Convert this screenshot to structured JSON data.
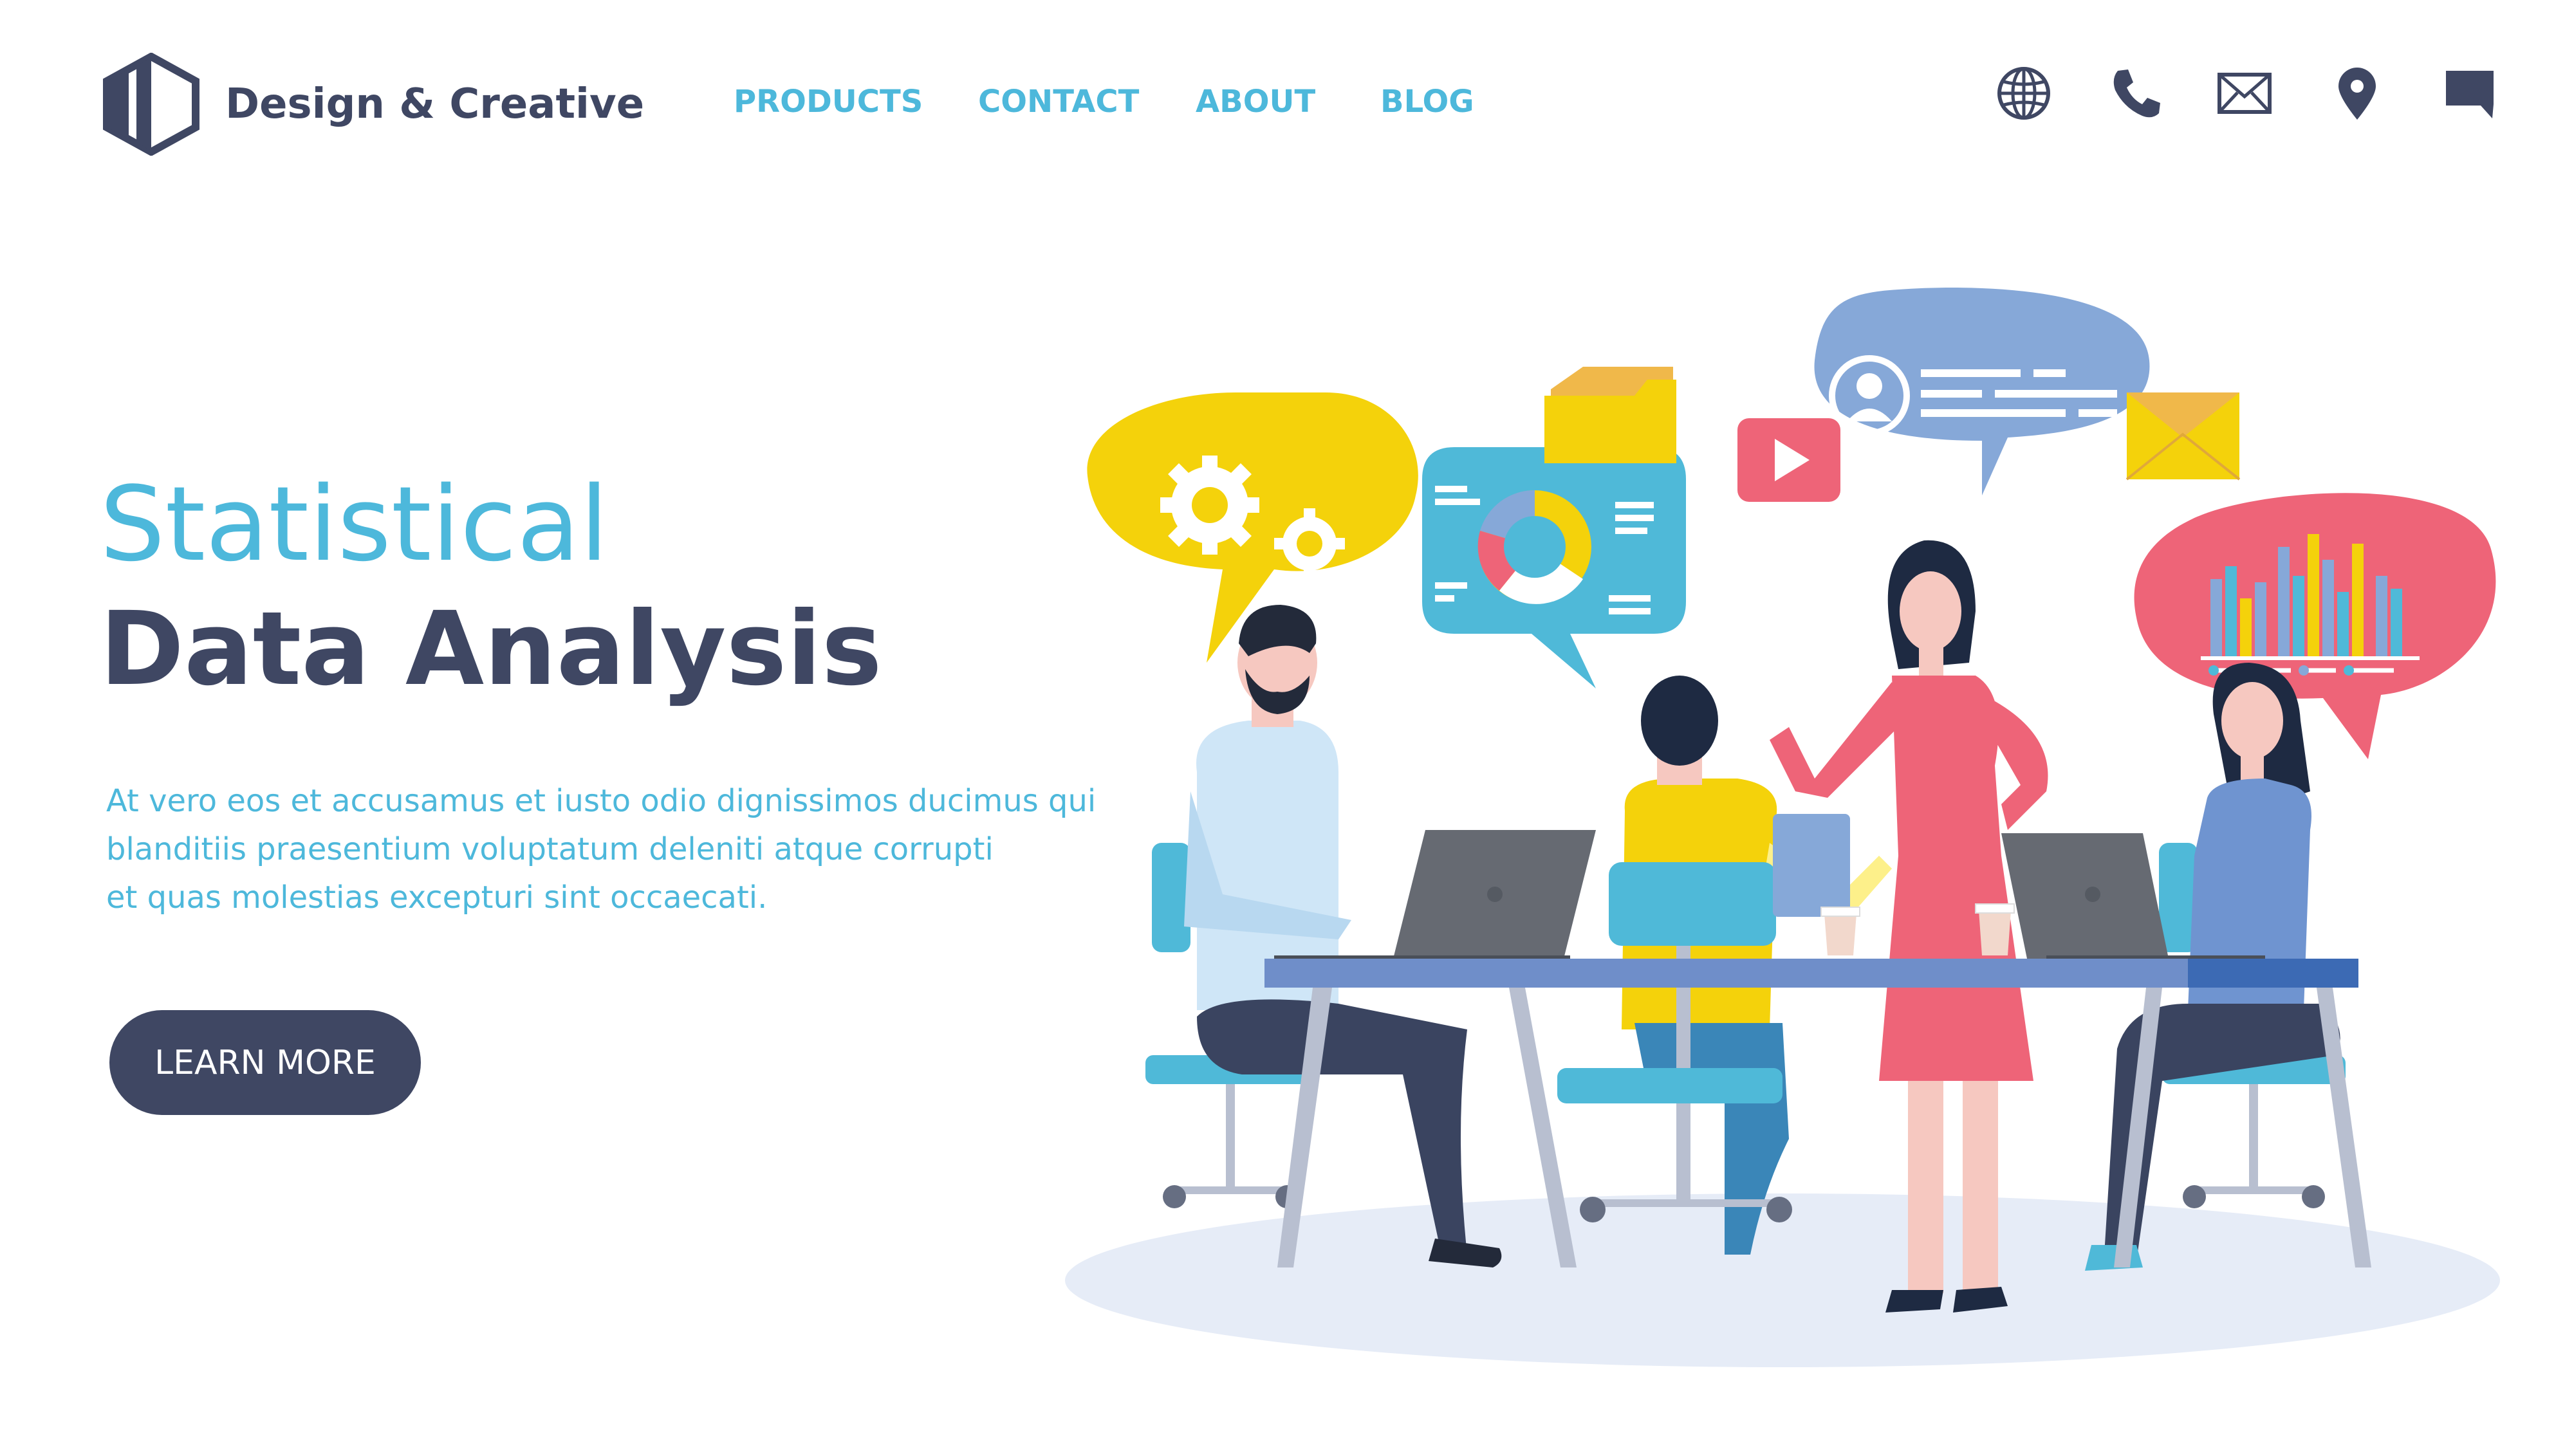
{
  "brand": {
    "name": "Design & Creative",
    "logo_icon": "hexagon-logo-icon"
  },
  "nav": {
    "items": [
      "PRODUCTS",
      "CONTACT",
      "ABOUT",
      "BLOG"
    ]
  },
  "header_icons": [
    "globe-icon",
    "phone-icon",
    "mail-icon",
    "location-pin-icon",
    "chat-icon"
  ],
  "hero": {
    "title_line1": "Statistical",
    "title_line2": "Data Analysis",
    "body_lines": [
      "At vero eos et accusamus et iusto odio dignissimos ducimus qui",
      "blanditiis praesentium voluptatum deleniti atque corrupti",
      "et quas molestias excepturi sint occaecati."
    ],
    "cta_label": "LEARN MORE"
  },
  "colors": {
    "navy": "#3f4763",
    "cyan": "#4db8db",
    "yellow": "#f4d20b",
    "pink": "#ee6478",
    "blue": "#86a8d8",
    "teal": "#4fb9d8"
  }
}
